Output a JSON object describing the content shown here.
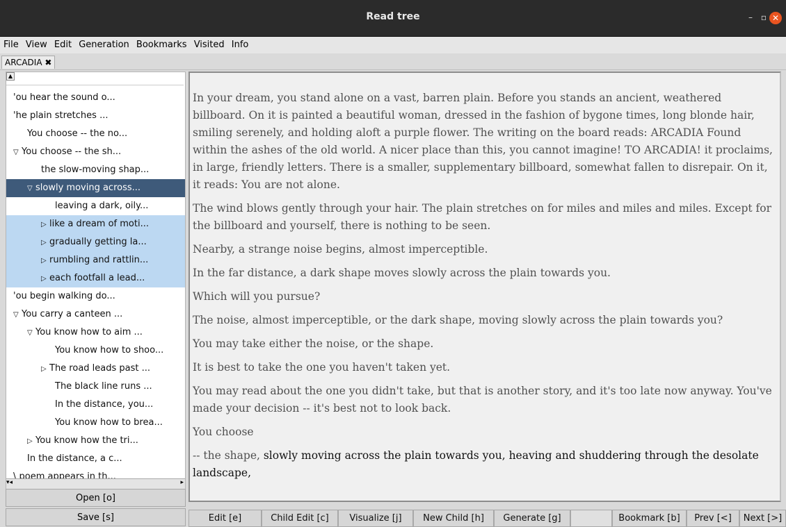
{
  "window": {
    "title": "Read tree",
    "minimize_label": "–",
    "maximize_label": "▫",
    "close_label": "✕"
  },
  "menu": [
    "File",
    "View",
    "Edit",
    "Generation",
    "Bookmarks",
    "Visited",
    "Info"
  ],
  "tab": {
    "label": "ARCADIA",
    "close_label": "✖"
  },
  "tree": {
    "nodes": [
      {
        "label": "'ou hear the sound o...",
        "indent": 0,
        "toggle": "",
        "state": ""
      },
      {
        "label": "'he plain stretches ...",
        "indent": 0,
        "toggle": "",
        "state": ""
      },
      {
        "label": "You choose -- the no...",
        "indent": 1,
        "toggle": "",
        "state": ""
      },
      {
        "label": "You choose -- the sh...",
        "indent": 0,
        "toggle": "▽",
        "state": ""
      },
      {
        "label": "the slow-moving shap...",
        "indent": 2,
        "toggle": "",
        "state": ""
      },
      {
        "label": "slowly moving across...",
        "indent": 1,
        "toggle": "▽",
        "state": "selected"
      },
      {
        "label": "leaving a dark, oily...",
        "indent": 3,
        "toggle": "",
        "state": ""
      },
      {
        "label": "like a dream of moti...",
        "indent": 2,
        "toggle": "▷",
        "state": "highlight"
      },
      {
        "label": "gradually getting la...",
        "indent": 2,
        "toggle": "▷",
        "state": "highlight"
      },
      {
        "label": "rumbling and rattlin...",
        "indent": 2,
        "toggle": "▷",
        "state": "highlight"
      },
      {
        "label": "each footfall a lead...",
        "indent": 2,
        "toggle": "▷",
        "state": "highlight"
      },
      {
        "label": "'ou begin walking do...",
        "indent": 0,
        "toggle": "",
        "state": ""
      },
      {
        "label": "You carry a canteen ...",
        "indent": 0,
        "toggle": "▽",
        "state": ""
      },
      {
        "label": "You know how to aim ...",
        "indent": 1,
        "toggle": "▽",
        "state": ""
      },
      {
        "label": "You know how to shoo...",
        "indent": 3,
        "toggle": "",
        "state": ""
      },
      {
        "label": "The road leads past ...",
        "indent": 2,
        "toggle": "▷",
        "state": ""
      },
      {
        "label": "The black line runs ...",
        "indent": 3,
        "toggle": "",
        "state": ""
      },
      {
        "label": "In the distance, you...",
        "indent": 3,
        "toggle": "",
        "state": ""
      },
      {
        "label": "You know how to brea...",
        "indent": 3,
        "toggle": "",
        "state": ""
      },
      {
        "label": "You know how the tri...",
        "indent": 1,
        "toggle": "▷",
        "state": ""
      },
      {
        "label": "In the distance, a c...",
        "indent": 1,
        "toggle": "",
        "state": ""
      },
      {
        "label": "\\ poem appears in th...",
        "indent": 0,
        "toggle": "",
        "state": ""
      }
    ]
  },
  "left_buttons": {
    "open": "Open [o]",
    "save": "Save [s]"
  },
  "story": {
    "paragraphs": [
      "In your dream, you stand alone on a vast, barren plain. Before you stands an ancient, weathered billboard. On it is painted a beautiful woman, dressed in the fashion of bygone times, long blonde hair, smiling serenely, and holding aloft a purple flower. The writing on the board reads: ARCADIA Found within the ashes of the old world. A nicer place than this, you cannot imagine! TO ARCADIA! it proclaims, in large, friendly letters. There is a smaller, supplementary billboard, somewhat fallen to disrepair. On it, it reads: You are not alone.",
      "The wind blows gently through your hair. The plain stretches on for miles and miles and miles. Except for the billboard and yourself, there is nothing to be seen.",
      "Nearby, a strange noise begins, almost imperceptible.",
      "In the far distance, a dark shape moves slowly across the plain towards you.",
      "Which will you pursue?",
      "The noise, almost imperceptible, or the dark shape, moving slowly across the plain towards you?",
      "You may take either the noise, or the shape.",
      "It is best to take the one you haven't taken yet.",
      "You may read about the one you didn't take, but that is another story, and it's too late now anyway. You've made your decision -- it's best not to look back.",
      "You choose"
    ],
    "last_prefix": "-- the shape, ",
    "last_current": "slowly moving across the plain towards you, heaving and shuddering through the desolate landscape,"
  },
  "bottom_buttons": {
    "edit": "Edit [e]",
    "child_edit": "Child Edit [c]",
    "visualize": "Visualize [j]",
    "new_child": "New Child [h]",
    "generate": "Generate [g]",
    "bookmark": "Bookmark [b]",
    "prev": "Prev [<]",
    "next": "Next [>]"
  }
}
